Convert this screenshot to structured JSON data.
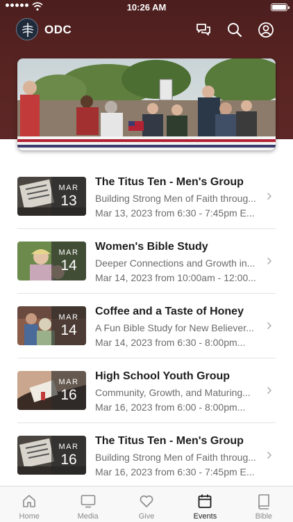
{
  "status_bar": {
    "time": "10:26 AM",
    "signal_icon": "signal-dots-icon",
    "wifi_icon": "wifi-icon",
    "battery_icon": "battery-icon",
    "battery_level": 1.0
  },
  "header": {
    "title": "ODC",
    "logo_icon": "church-logo-icon",
    "actions": [
      {
        "name": "chat-icon"
      },
      {
        "name": "search-icon"
      },
      {
        "name": "profile-icon"
      }
    ]
  },
  "hero": {
    "image": "group-photo-parade-float"
  },
  "events": [
    {
      "title": "The Titus Ten - Men's Group",
      "subtitle": "Building Strong Men of Faith throug...",
      "time": "Mar 13, 2023 from 6:30 - 7:45pm E...",
      "month": "MAR",
      "day": "13",
      "thumb": "titus-ten"
    },
    {
      "title": "Women's Bible Study",
      "subtitle": "Deeper Connections and Growth in...",
      "time": "Mar 14, 2023 from 10:00am - 12:00...",
      "month": "MAR",
      "day": "14",
      "thumb": "womens-study"
    },
    {
      "title": "Coffee and a Taste of Honey",
      "subtitle": "A Fun Bible Study for New Believer...",
      "time": "Mar 14, 2023 from 6:30 - 8:00pm...",
      "month": "MAR",
      "day": "14",
      "thumb": "coffee-honey"
    },
    {
      "title": "High School Youth Group",
      "subtitle": "Community, Growth, and Maturing...",
      "time": "Mar 16, 2023 from 6:00 - 8:00pm...",
      "month": "MAR",
      "day": "16",
      "thumb": "youth-group"
    },
    {
      "title": "The Titus Ten - Men's Group",
      "subtitle": "Building Strong Men of Faith throug...",
      "time": "Mar 16, 2023 from 6:30 - 7:45pm E...",
      "month": "MAR",
      "day": "16",
      "thumb": "titus-ten"
    }
  ],
  "tabs": [
    {
      "label": "Home",
      "icon": "home-icon",
      "active": false
    },
    {
      "label": "Media",
      "icon": "media-icon",
      "active": false
    },
    {
      "label": "Give",
      "icon": "heart-icon",
      "active": false
    },
    {
      "label": "Events",
      "icon": "calendar-icon",
      "active": true
    },
    {
      "label": "Bible",
      "icon": "bible-icon",
      "active": false
    }
  ],
  "colors": {
    "header_bg": "#5a2523",
    "title_text": "#1d1d1d",
    "secondary_text": "#6b6b6b",
    "active_tab": "#1a1a1a",
    "inactive_tab": "#8a8a8a"
  }
}
